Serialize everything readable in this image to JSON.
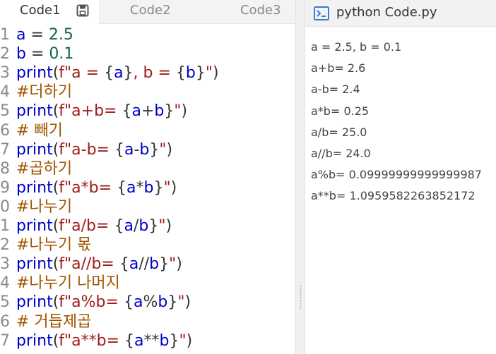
{
  "tabs": [
    {
      "label": "Code1"
    },
    {
      "label": "Code2"
    },
    {
      "label": "Code3"
    }
  ],
  "icons": {
    "save": "save-icon",
    "terminal": "terminal-icon"
  },
  "colors": {
    "keyword": "#0000cc",
    "string": "#a11b1b",
    "number": "#116644",
    "comment": "#a05500",
    "terminal_icon": "#3a7bd5"
  },
  "code": {
    "lines": [
      {
        "n": "1",
        "parts": [
          {
            "t": "a",
            "c": "var"
          },
          {
            "t": " = ",
            "c": "op"
          },
          {
            "t": "2.5",
            "c": "num"
          }
        ]
      },
      {
        "n": "2",
        "parts": [
          {
            "t": "b",
            "c": "var"
          },
          {
            "t": " = ",
            "c": "op"
          },
          {
            "t": "0.1",
            "c": "num"
          }
        ]
      },
      {
        "n": "3",
        "parts": [
          {
            "t": "print",
            "c": "kw"
          },
          {
            "t": "(",
            "c": "op"
          },
          {
            "t": "f\"a = ",
            "c": "str"
          },
          {
            "t": "{",
            "c": "op"
          },
          {
            "t": "a",
            "c": "var"
          },
          {
            "t": "}",
            "c": "op"
          },
          {
            "t": ", b = ",
            "c": "str"
          },
          {
            "t": "{",
            "c": "op"
          },
          {
            "t": "b",
            "c": "var"
          },
          {
            "t": "}",
            "c": "op"
          },
          {
            "t": "\"",
            "c": "str"
          },
          {
            "t": ")",
            "c": "op"
          }
        ]
      },
      {
        "n": "4",
        "parts": [
          {
            "t": "#더하기",
            "c": "cmt"
          }
        ]
      },
      {
        "n": "5",
        "parts": [
          {
            "t": "print",
            "c": "kw"
          },
          {
            "t": "(",
            "c": "op"
          },
          {
            "t": "f\"a+b= ",
            "c": "str"
          },
          {
            "t": "{",
            "c": "op"
          },
          {
            "t": "a",
            "c": "var"
          },
          {
            "t": "+",
            "c": "op"
          },
          {
            "t": "b",
            "c": "var"
          },
          {
            "t": "}",
            "c": "op"
          },
          {
            "t": "\"",
            "c": "str"
          },
          {
            "t": ")",
            "c": "op"
          }
        ]
      },
      {
        "n": "6",
        "parts": [
          {
            "t": "# 빼기",
            "c": "cmt"
          }
        ]
      },
      {
        "n": "7",
        "parts": [
          {
            "t": "print",
            "c": "kw"
          },
          {
            "t": "(",
            "c": "op"
          },
          {
            "t": "f\"a-b= ",
            "c": "str"
          },
          {
            "t": "{",
            "c": "op"
          },
          {
            "t": "a",
            "c": "var"
          },
          {
            "t": "-",
            "c": "op"
          },
          {
            "t": "b",
            "c": "var"
          },
          {
            "t": "}",
            "c": "op"
          },
          {
            "t": "\"",
            "c": "str"
          },
          {
            "t": ")",
            "c": "op"
          }
        ]
      },
      {
        "n": "8",
        "parts": [
          {
            "t": "#곱하기",
            "c": "cmt"
          }
        ]
      },
      {
        "n": "9",
        "parts": [
          {
            "t": "print",
            "c": "kw"
          },
          {
            "t": "(",
            "c": "op"
          },
          {
            "t": "f\"a*b= ",
            "c": "str"
          },
          {
            "t": "{",
            "c": "op"
          },
          {
            "t": "a",
            "c": "var"
          },
          {
            "t": "*",
            "c": "op"
          },
          {
            "t": "b",
            "c": "var"
          },
          {
            "t": "}",
            "c": "op"
          },
          {
            "t": "\"",
            "c": "str"
          },
          {
            "t": ")",
            "c": "op"
          }
        ]
      },
      {
        "n": "10",
        "parts": [
          {
            "t": "#나누기",
            "c": "cmt"
          }
        ]
      },
      {
        "n": "11",
        "parts": [
          {
            "t": "print",
            "c": "kw"
          },
          {
            "t": "(",
            "c": "op"
          },
          {
            "t": "f\"a/b= ",
            "c": "str"
          },
          {
            "t": "{",
            "c": "op"
          },
          {
            "t": "a",
            "c": "var"
          },
          {
            "t": "/",
            "c": "op"
          },
          {
            "t": "b",
            "c": "var"
          },
          {
            "t": "}",
            "c": "op"
          },
          {
            "t": "\"",
            "c": "str"
          },
          {
            "t": ")",
            "c": "op"
          }
        ]
      },
      {
        "n": "12",
        "parts": [
          {
            "t": "#나누기 몫",
            "c": "cmt"
          }
        ]
      },
      {
        "n": "13",
        "parts": [
          {
            "t": "print",
            "c": "kw"
          },
          {
            "t": "(",
            "c": "op"
          },
          {
            "t": "f\"a//b= ",
            "c": "str"
          },
          {
            "t": "{",
            "c": "op"
          },
          {
            "t": "a",
            "c": "var"
          },
          {
            "t": "//",
            "c": "op"
          },
          {
            "t": "b",
            "c": "var"
          },
          {
            "t": "}",
            "c": "op"
          },
          {
            "t": "\"",
            "c": "str"
          },
          {
            "t": ")",
            "c": "op"
          }
        ]
      },
      {
        "n": "14",
        "parts": [
          {
            "t": "#나누기 나머지",
            "c": "cmt"
          }
        ]
      },
      {
        "n": "15",
        "parts": [
          {
            "t": "print",
            "c": "kw"
          },
          {
            "t": "(",
            "c": "op"
          },
          {
            "t": "f\"a%b= ",
            "c": "str"
          },
          {
            "t": "{",
            "c": "op"
          },
          {
            "t": "a",
            "c": "var"
          },
          {
            "t": "%",
            "c": "op"
          },
          {
            "t": "b",
            "c": "var"
          },
          {
            "t": "}",
            "c": "op"
          },
          {
            "t": "\"",
            "c": "str"
          },
          {
            "t": ")",
            "c": "op"
          }
        ]
      },
      {
        "n": "16",
        "parts": [
          {
            "t": "# 거듭제곱",
            "c": "cmt"
          }
        ]
      },
      {
        "n": "17",
        "parts": [
          {
            "t": "print",
            "c": "kw"
          },
          {
            "t": "(",
            "c": "op"
          },
          {
            "t": "f\"a**b= ",
            "c": "str"
          },
          {
            "t": "{",
            "c": "op"
          },
          {
            "t": "a",
            "c": "var"
          },
          {
            "t": "**",
            "c": "op"
          },
          {
            "t": "b",
            "c": "var"
          },
          {
            "t": "}",
            "c": "op"
          },
          {
            "t": "\"",
            "c": "str"
          },
          {
            "t": ")",
            "c": "op"
          }
        ]
      }
    ]
  },
  "output": {
    "title": "python Code.py",
    "lines": [
      "a = 2.5, b = 0.1",
      "a+b= 2.6",
      "a-b= 2.4",
      "a*b= 0.25",
      "a/b= 25.0",
      "a//b= 24.0",
      "a%b= 0.09999999999999987",
      "a**b= 1.0959582263852172"
    ]
  }
}
